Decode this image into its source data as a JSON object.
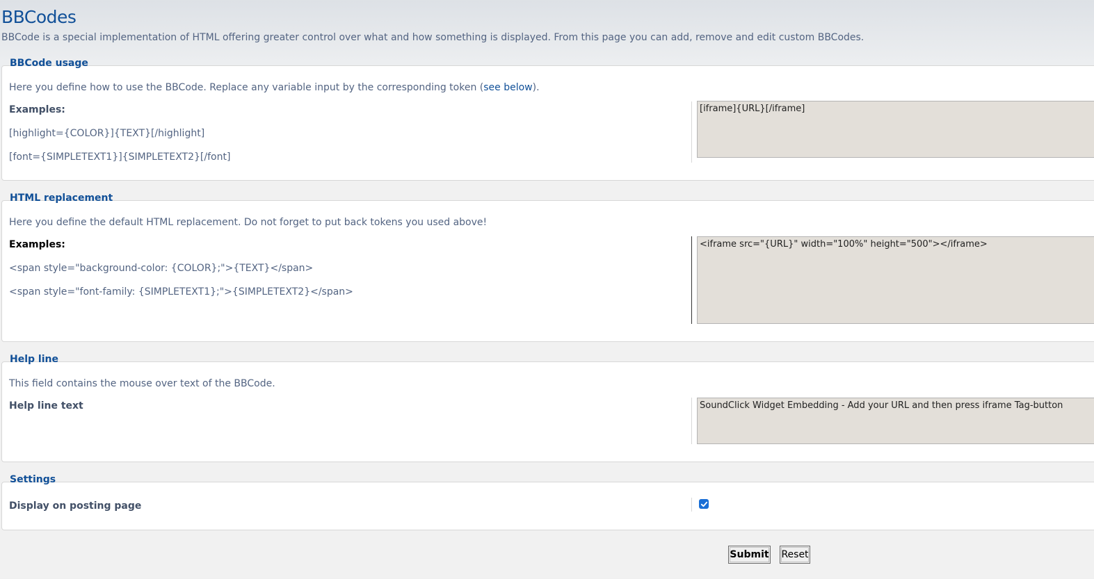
{
  "header": {
    "title": "BBCodes",
    "description": "BBCode is a special implementation of HTML offering greater control over what and how something is displayed. From this page you can add, remove and edit custom BBCodes."
  },
  "usage": {
    "legend": "BBCode usage",
    "intro_before": "Here you define how to use the BBCode. Replace any variable input by the corresponding token (",
    "intro_link": "see below",
    "intro_after": ").",
    "examples_label": "Examples:",
    "examples": [
      "[highlight={COLOR}]{TEXT}[/highlight]",
      "[font={SIMPLETEXT1}]{SIMPLETEXT2}[/font]"
    ],
    "value": "[iframe]{URL}[/iframe]"
  },
  "html": {
    "legend": "HTML replacement",
    "intro": "Here you define the default HTML replacement. Do not forget to put back tokens you used above!",
    "examples_label": "Examples:",
    "examples": [
      "<span style=\"background-color: {COLOR};\">{TEXT}</span>",
      "<span style=\"font-family: {SIMPLETEXT1};\">{SIMPLETEXT2}</span>"
    ],
    "value": "<iframe src=\"{URL}\" width=\"100%\" height=\"500\"></iframe>"
  },
  "helpline": {
    "legend": "Help line",
    "intro": "This field contains the mouse over text of the BBCode.",
    "label": "Help line text",
    "value": "SoundClick Widget Embedding - Add your URL and then press iframe Tag-button"
  },
  "settings": {
    "legend": "Settings",
    "display_label": "Display on posting page",
    "display_checked": true
  },
  "buttons": {
    "submit": "Submit",
    "reset": "Reset"
  },
  "colors": {
    "accent": "#115098",
    "text": "#536482",
    "textarea_bg": "#e3dfd9",
    "checkbox": "#1a6fd6"
  }
}
